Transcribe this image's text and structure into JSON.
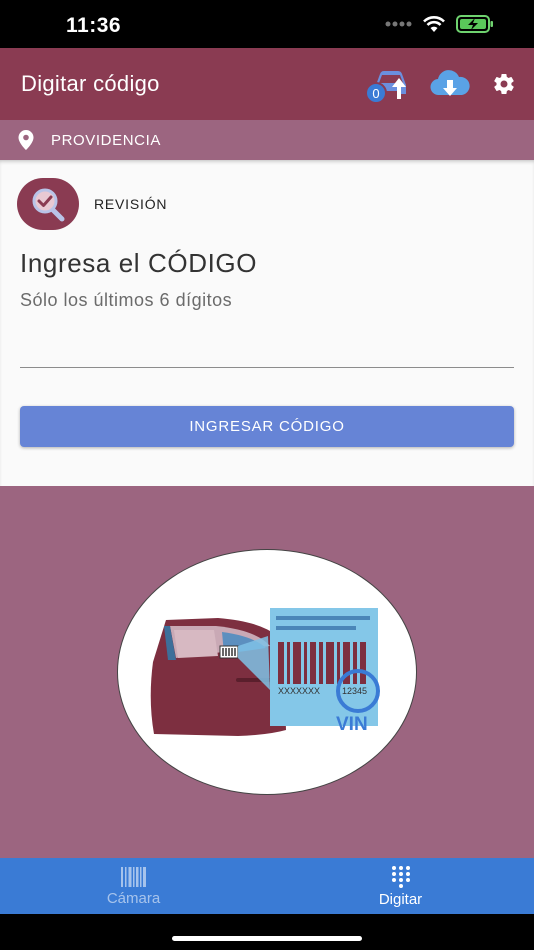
{
  "status": {
    "time": "11:36"
  },
  "app_bar": {
    "title": "Digitar código",
    "upload_badge": "0"
  },
  "location": {
    "name": "PROVIDENCIA"
  },
  "card": {
    "mode_label": "REVISIÓN",
    "prompt_title": "Ingresa el CÓDIGO",
    "prompt_subtitle": "Sólo los últimos 6 dígitos",
    "code_value": "",
    "submit_label": "INGRESAR CÓDIGO"
  },
  "illustration": {
    "sample_code": "XXXXXXX",
    "sample_digits": "12345",
    "vin_label": "VIN"
  },
  "tabs": [
    {
      "label": "Cámara",
      "icon": "barcode-icon",
      "active": false
    },
    {
      "label": "Digitar",
      "icon": "keypad-icon",
      "active": true
    }
  ],
  "colors": {
    "app_bar": "#8a3b52",
    "location_bar": "#9c6580",
    "accent_button": "#6684d6",
    "tab_bar": "#3a7bd5"
  }
}
